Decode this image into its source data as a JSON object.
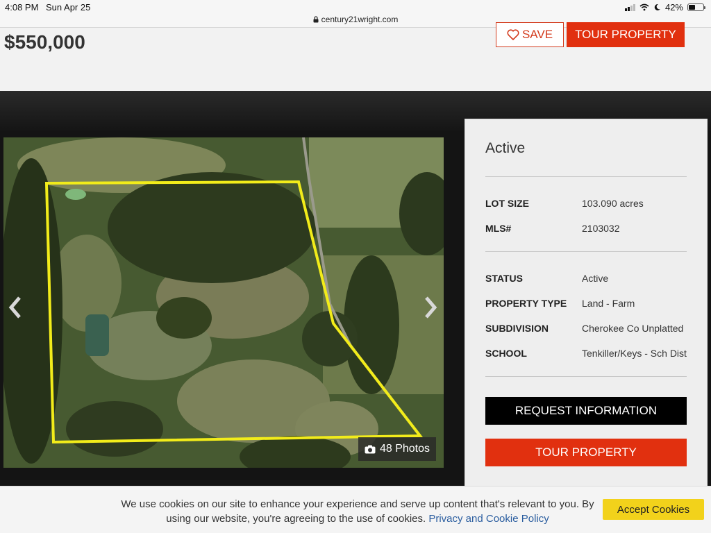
{
  "status_bar": {
    "time": "4:08 PM",
    "date": "Sun Apr 25",
    "battery": "42%",
    "battery_level": 0.42
  },
  "browser": {
    "url": "century21wright.com"
  },
  "header": {
    "price": "$550,000",
    "save_label": "SAVE",
    "tour_label": "TOUR PROPERTY"
  },
  "gallery": {
    "photo_count_label": "48 Photos"
  },
  "details": {
    "status_title": "Active",
    "group1": [
      {
        "label": "LOT SIZE",
        "value": "103.090 acres"
      },
      {
        "label": "MLS#",
        "value": "2103032"
      }
    ],
    "group2": [
      {
        "label": "STATUS",
        "value": "Active"
      },
      {
        "label": "PROPERTY TYPE",
        "value": "Land - Farm"
      },
      {
        "label": "SUBDIVISION",
        "value": "Cherokee Co Unplatted"
      },
      {
        "label": "SCHOOL",
        "value": "Tenkiller/Keys - Sch Dist"
      }
    ],
    "request_label": "REQUEST INFORMATION",
    "tour_label": "TOUR PROPERTY"
  },
  "cookie": {
    "message": "We use cookies on our site to enhance your experience and serve up content that's relevant to you. By using our website, you're agreeing to the use of cookies.",
    "link": "Privacy and Cookie Policy",
    "accept_label": "Accept Cookies"
  },
  "colors": {
    "accent": "#e1300f",
    "boundary": "#f2ec1a",
    "cookie_button": "#f2d21b"
  }
}
